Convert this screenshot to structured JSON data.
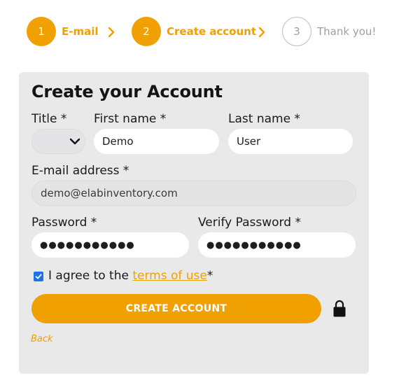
{
  "stepper": {
    "steps": [
      {
        "number": "1",
        "label": "E-mail",
        "state": "active"
      },
      {
        "number": "2",
        "label": "Create account",
        "state": "active"
      },
      {
        "number": "3",
        "label": "Thank you!",
        "state": "inactive"
      }
    ]
  },
  "form": {
    "title": "Create your Account",
    "title_label": "Title *",
    "title_value": "",
    "first_name_label": "First name *",
    "first_name_value": "Demo",
    "last_name_label": "Last name *",
    "last_name_value": "User",
    "email_label": "E-mail address *",
    "email_value": "demo@elabinventory.com",
    "password_label": "Password *",
    "password_value": "●●●●●●●●●●●",
    "verify_password_label": "Verify Password *",
    "verify_password_value": "●●●●●●●●●●●",
    "agree_prefix": "I agree to the",
    "terms_link": "terms of use",
    "agree_suffix": "*",
    "agree_checked": true,
    "submit_label": "CREATE ACCOUNT",
    "back_label": "Back"
  },
  "colors": {
    "accent": "#f0a000",
    "card_bg": "#e9e9ea",
    "checkbox": "#1a73e8"
  },
  "icons": {
    "step_separator": "chevron-right-icon",
    "select_arrow": "chevron-down-icon",
    "lock": "lock-icon",
    "checkbox": "checkmark-icon"
  }
}
